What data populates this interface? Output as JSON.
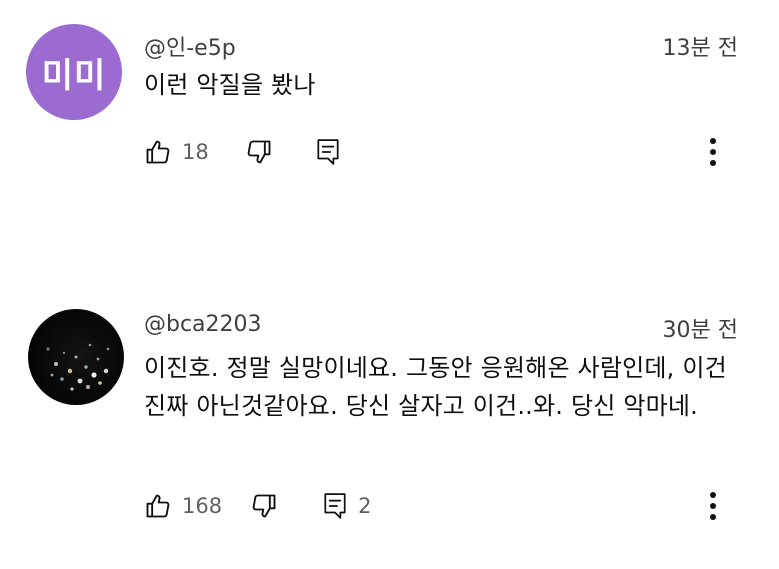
{
  "comments": [
    {
      "avatar_text": "미미",
      "avatar_color": "#9c6bd1",
      "handle": "@인-e5p",
      "time": "13분 전",
      "text": "이런 악질을 봤나",
      "likes": "18",
      "replies": ""
    },
    {
      "avatar_text": "",
      "avatar_color": "#0a0a0a",
      "handle": "@bca2203",
      "time": "30분 전",
      "text": "이진호. 정말 실망이네요. 그동안 응원해온 사람인데, 이건 진짜 아닌것같아요. 당신 살자고 이건..와. 당신 악마네.",
      "likes": "168",
      "replies": "2"
    }
  ],
  "icons": {
    "like": "thumbs-up-icon",
    "dislike": "thumbs-down-icon",
    "reply": "comment-icon",
    "more": "more-vertical-icon"
  }
}
